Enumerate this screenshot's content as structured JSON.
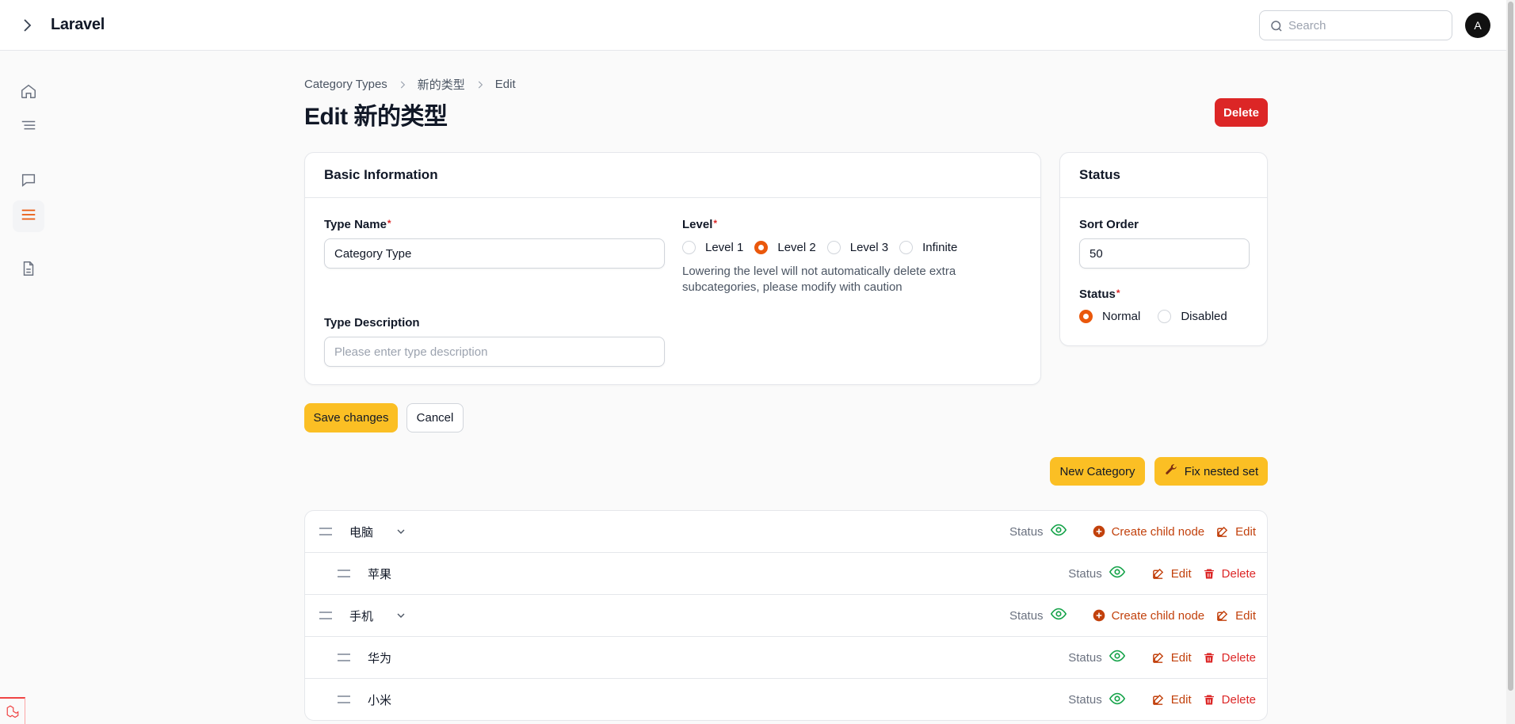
{
  "app": {
    "brand": "Laravel",
    "avatar_letter": "A"
  },
  "search": {
    "placeholder": "Search"
  },
  "sidebar": {
    "icons": [
      "home-icon",
      "list-icon",
      "chat-icon",
      "menu-icon",
      "document-icon"
    ],
    "active": "menu-icon"
  },
  "breadcrumb": {
    "items": [
      "Category Types",
      "新的类型",
      "Edit"
    ]
  },
  "page": {
    "title": "Edit 新的类型",
    "delete_label": "Delete"
  },
  "basic_info": {
    "title": "Basic Information",
    "type_name_label": "Type Name",
    "type_name_value": "Category Type",
    "level_label": "Level",
    "levels": [
      "Level 1",
      "Level 2",
      "Level 3",
      "Infinite"
    ],
    "selected_level": "Level 2",
    "level_hint": "Lowering the level will not automatically delete extra subcategories, please modify with caution",
    "type_desc_label": "Type Description",
    "type_desc_placeholder": "Please enter type description"
  },
  "status_card": {
    "title": "Status",
    "sort_order_label": "Sort Order",
    "sort_order_value": "50",
    "status_label": "Status",
    "options": [
      "Normal",
      "Disabled"
    ],
    "selected": "Normal"
  },
  "form_actions": {
    "save_label": "Save changes",
    "cancel_label": "Cancel"
  },
  "tree_actions": {
    "new_category_label": "New Category",
    "fix_label": "Fix nested set"
  },
  "tree": {
    "status_label": "Status",
    "create_child_label": "Create child node",
    "edit_label": "Edit",
    "delete_label": "Delete",
    "nodes": [
      {
        "name": "电脑",
        "level": 0,
        "expandable": true
      },
      {
        "name": "苹果",
        "level": 1,
        "expandable": false
      },
      {
        "name": "手机",
        "level": 0,
        "expandable": true
      },
      {
        "name": "华为",
        "level": 1,
        "expandable": false
      },
      {
        "name": "小米",
        "level": 1,
        "expandable": false
      }
    ]
  },
  "colors": {
    "primary": "#fbbf24",
    "danger": "#dc2626",
    "accent": "#ea580c",
    "status_ok": "#16a34a"
  }
}
